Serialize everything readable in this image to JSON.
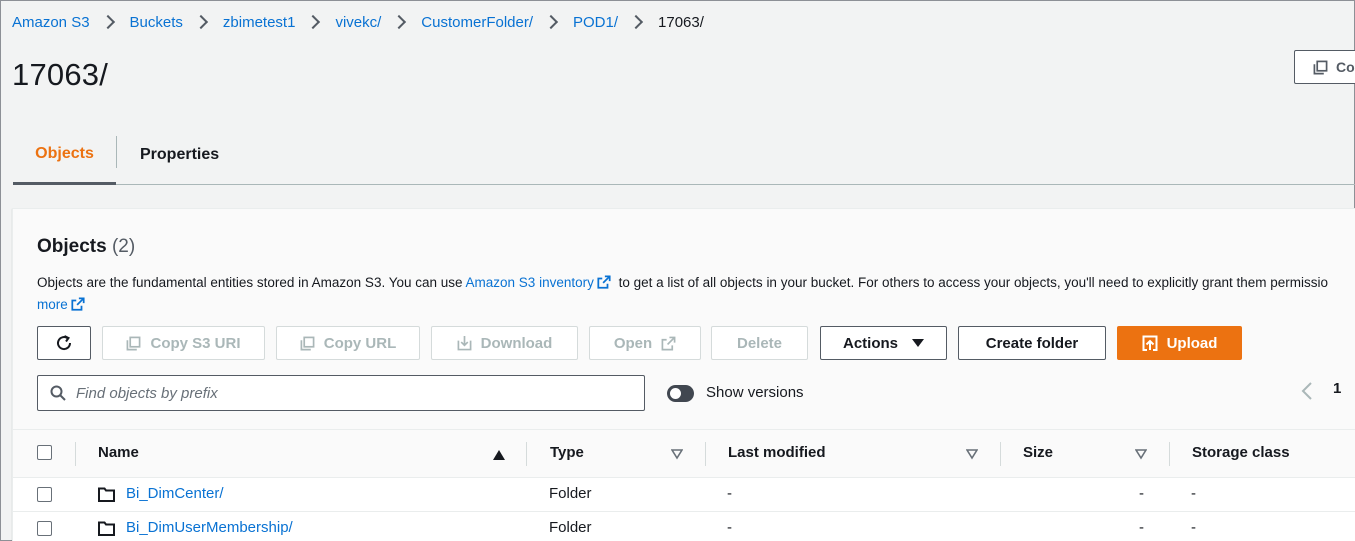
{
  "breadcrumb": {
    "items": [
      "Amazon S3",
      "Buckets",
      "zbimetest1",
      "vivekc/",
      "CustomerFolder/",
      "POD1/"
    ],
    "current": "17063/"
  },
  "page": {
    "title": "17063/",
    "copy_button_label": "Co"
  },
  "tabs": [
    {
      "label": "Objects",
      "active": true
    },
    {
      "label": "Properties",
      "active": false
    }
  ],
  "objects_panel": {
    "heading": "Objects",
    "count": "(2)",
    "description": {
      "text_before": "Objects are the fundamental entities stored in Amazon S3. You can use ",
      "link_inventory": "Amazon S3 inventory",
      "text_after": " to get a list of all objects in your bucket. For others to access your objects, you'll need to explicitly grant them permissio",
      "link_more": "more"
    },
    "buttons": {
      "copy_s3_uri": "Copy S3 URI",
      "copy_url": "Copy URL",
      "download": "Download",
      "open": "Open",
      "delete": "Delete",
      "actions": "Actions",
      "create_folder": "Create folder",
      "upload": "Upload"
    },
    "search": {
      "placeholder": "Find objects by prefix"
    },
    "show_versions_label": "Show versions",
    "pagination": {
      "current_page": "1"
    }
  },
  "table": {
    "columns": [
      "Name",
      "Type",
      "Last modified",
      "Size",
      "Storage class"
    ],
    "rows": [
      {
        "name": "Bi_DimCenter/",
        "type": "Folder",
        "last_modified": "-",
        "size": "-",
        "storage_class": "-"
      },
      {
        "name": "Bi_DimUserMembership/",
        "type": "Folder",
        "last_modified": "-",
        "size": "-",
        "storage_class": "-"
      }
    ]
  },
  "colors": {
    "accent": "#ec7211",
    "link": "#0972d3",
    "text": "#16191f"
  }
}
